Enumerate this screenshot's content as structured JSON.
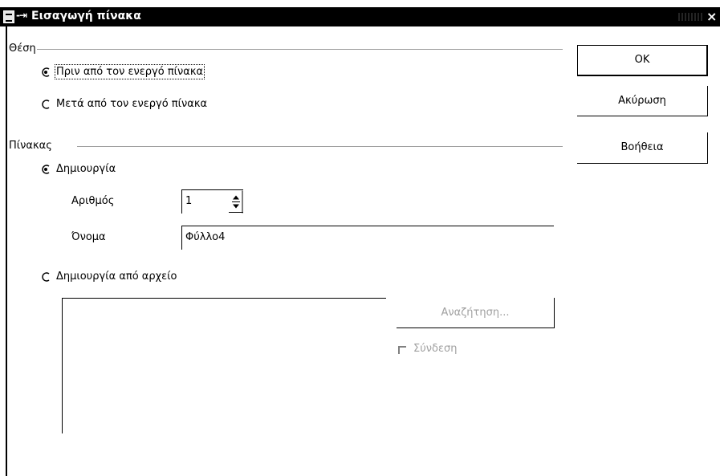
{
  "window": {
    "title": "Εισαγωγή πίνακα",
    "system_menu": "-⇥",
    "close_glyph": "×"
  },
  "position": {
    "label": "Θέση",
    "options": [
      {
        "label": "Πριν από τον ενεργό πίνακα",
        "selected": true
      },
      {
        "label": "Μετά από τον ενεργό πίνακα",
        "selected": false
      }
    ]
  },
  "sheet": {
    "label": "Πίνακας",
    "create": {
      "label": "Δημιουργία",
      "selected": true
    },
    "number": {
      "label": "Αριθμός",
      "value": "1"
    },
    "name": {
      "label": "Όνομα",
      "value": "Φύλλο4"
    },
    "from_file": {
      "label": "Δημιουργία από αρχείο",
      "selected": false
    },
    "browse_label": "Αναζήτηση...",
    "link_label": "Σύνδεση"
  },
  "buttons": {
    "ok": "OK",
    "cancel": "Ακύρωση",
    "help": "Βοήθεια"
  },
  "colors": {
    "titlebar": "#000000",
    "disabled_text": "#a0a0a0"
  }
}
